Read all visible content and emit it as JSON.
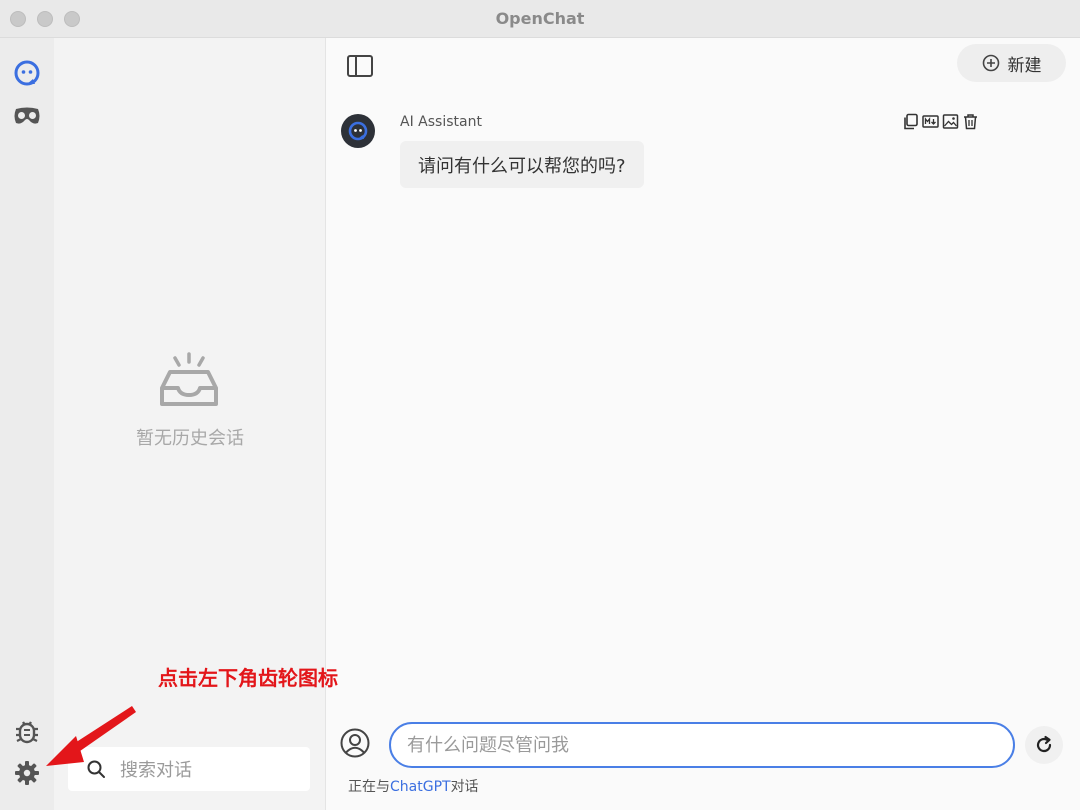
{
  "window": {
    "title": "OpenChat"
  },
  "rail": {
    "top_items": [
      {
        "icon": "chat-bot-icon"
      },
      {
        "icon": "vr-mask-icon"
      }
    ],
    "bottom_items": [
      {
        "icon": "bug-icon"
      },
      {
        "icon": "gear-icon"
      }
    ]
  },
  "history": {
    "empty_text": "暂无历史会话",
    "search_placeholder": "搜索对话"
  },
  "chat": {
    "new_label": "新建",
    "message": {
      "sender": "AI Assistant",
      "text": "请问有什么可以帮您的吗?",
      "actions": [
        "copy-icon",
        "markdown-icon",
        "image-icon",
        "trash-icon"
      ]
    },
    "input_placeholder": "有什么问题尽管问我",
    "status_prefix": "正在与",
    "status_model": "ChatGPT",
    "status_suffix": "对话"
  },
  "annotation": {
    "text": "点击左下角齿轮图标",
    "color": "#e3161a"
  },
  "colors": {
    "accent": "#4a7fe6",
    "link": "#3b6fe0"
  }
}
